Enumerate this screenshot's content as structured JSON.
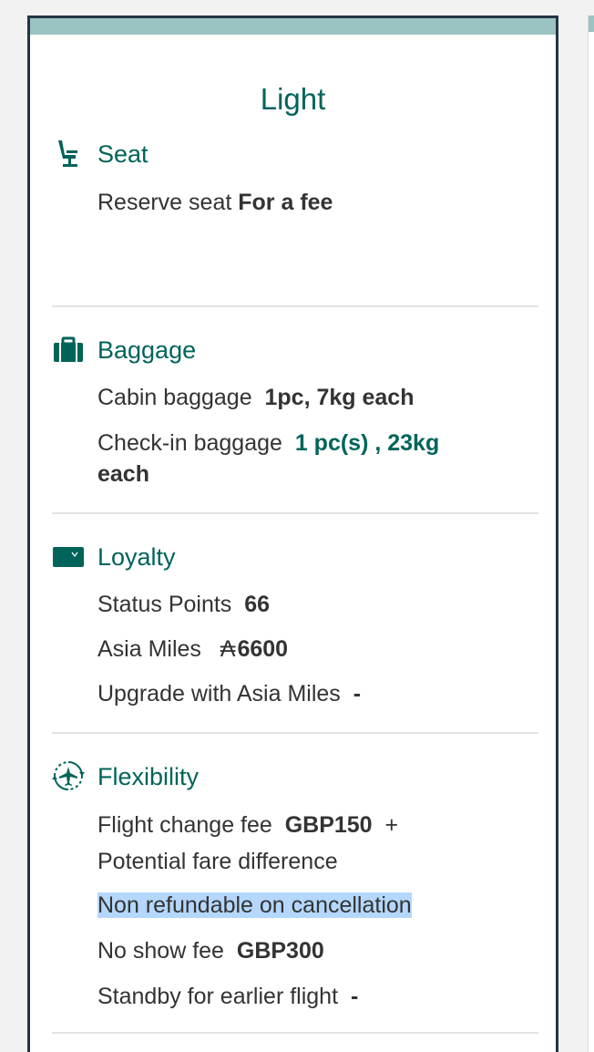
{
  "fare": {
    "title": "Light"
  },
  "sections": {
    "seat": {
      "title": "Seat",
      "icon": "seat-icon",
      "reserve_label": "Reserve seat",
      "reserve_value": "For a fee"
    },
    "baggage": {
      "title": "Baggage",
      "icon": "suitcase-icon",
      "cabin_label": "Cabin baggage",
      "cabin_value": "1pc, 7kg each",
      "checkin_label": "Check-in baggage",
      "checkin_value_line1": "1 pc(s) , 23kg",
      "checkin_value_line2": "each"
    },
    "loyalty": {
      "title": "Loyalty",
      "icon": "membership-card-icon",
      "status_label": "Status Points",
      "status_value": "66",
      "miles_label": "Asia Miles",
      "miles_symbol": "₳",
      "miles_value": "6600",
      "upgrade_label": "Upgrade with Asia Miles",
      "upgrade_value": "-"
    },
    "flexibility": {
      "title": "Flexibility",
      "icon": "plane-circle-arrows-icon",
      "change_label": "Flight change fee",
      "change_value": "GBP150",
      "change_plus": "+",
      "change_note": "Potential fare difference",
      "refund_text": "Non refundable on cancellation",
      "noshow_label": "No show fee",
      "noshow_value": "GBP300",
      "standby_label": "Standby for earlier flight",
      "standby_value": "-"
    }
  },
  "colors": {
    "accent": "#00645a",
    "card_border": "#233546",
    "topbar": "#9bc3c2",
    "text": "#333333",
    "selection": "#b4d7fb"
  }
}
